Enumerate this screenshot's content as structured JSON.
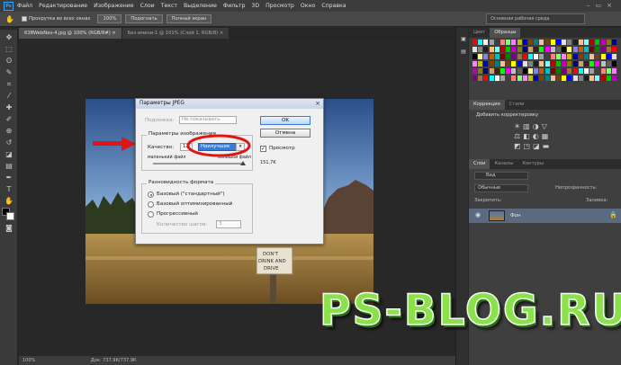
{
  "menu": {
    "logo": "Ps",
    "items": [
      "Файл",
      "Редактирование",
      "Изображение",
      "Слои",
      "Текст",
      "Выделение",
      "Фильтр",
      "3D",
      "Просмотр",
      "Окно",
      "Справка"
    ]
  },
  "options": {
    "checkbox_label": "Прокрутка во всех окнах",
    "zoom_button": "100%",
    "fit_button": "Подогнать",
    "fullscreen_button": "Полный экран",
    "workspace": "Основная рабочая среда"
  },
  "tabs": [
    {
      "label": "63BWebNav-4.jpg @ 100% (RGB/8#) ×",
      "active": true
    },
    {
      "label": "Без имени-1 @ 101% (Слой 1, RGB/8) ×",
      "active": false
    }
  ],
  "photo": {
    "sign_text": [
      "DON'T",
      "DRINK AND",
      "DRIVE"
    ]
  },
  "status": "100%",
  "status_doc": "Док: 737,9К/737,9К",
  "dialog": {
    "title": "Параметры JPEG",
    "ok": "OK",
    "cancel": "Отмена",
    "matte_label": "Подложка:",
    "matte_value": "Не показывать",
    "image_options_title": "Параметры изображения",
    "quality_label": "Качество:",
    "quality_value": "12",
    "quality_preset": "Наилучшее",
    "small_file": "маленький файл",
    "large_file": "большой файл",
    "preview_label": "Просмотр",
    "filesize": "151,7K",
    "format_title": "Разновидность формата",
    "format_options": [
      "Базовый (\"стандартный\")",
      "Базовый оптимизированный",
      "Прогрессивный"
    ],
    "scans_label": "Количество шагов:",
    "scans_value": "3",
    "selected_format": 0,
    "quality_fraction": 1.0
  },
  "panels": {
    "swatches_tabs": [
      "Цвет",
      "Образцы"
    ],
    "adjust_tabs": [
      "Коррекция",
      "Стили"
    ],
    "adjust_title": "Добавить корректировку",
    "layers_tabs": [
      "Слои",
      "Каналы",
      "Контуры"
    ],
    "kind_label": "Вид",
    "blend_mode": "Обычные",
    "opacity_label": "Непрозрачность:",
    "lock_label": "Закрепить:",
    "fill_label": "Заливка:",
    "layer_name": "Фон"
  },
  "watermark": "PS-BLOG.RU",
  "colors": {
    "accent": "#31a8ff",
    "annotation_arrow": "#e01515",
    "watermark": "#8be04b"
  }
}
